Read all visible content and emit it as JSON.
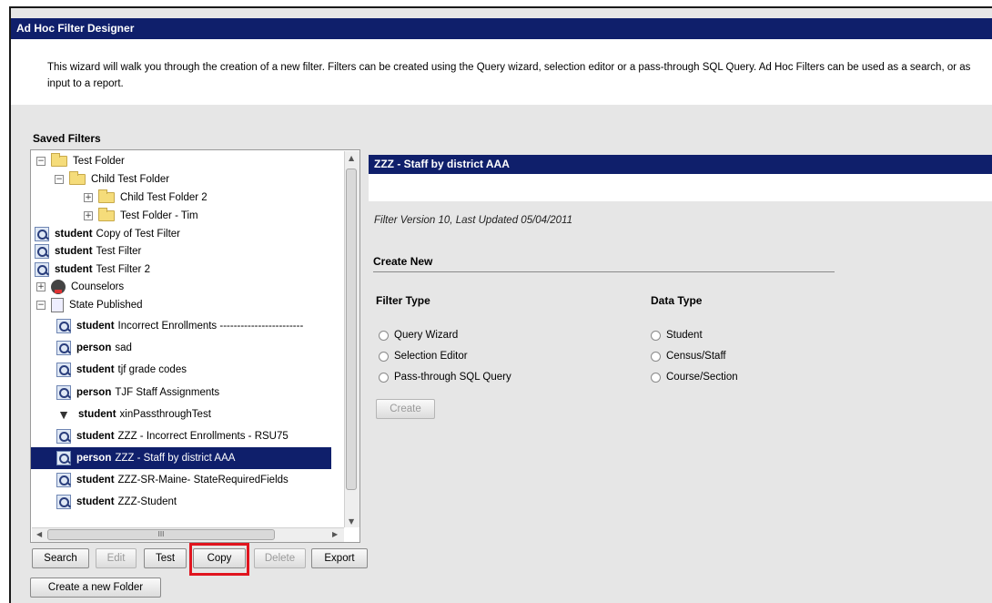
{
  "window": {
    "title": "Ad Hoc Filter Designer"
  },
  "intro": {
    "text": "This wizard will walk you through the creation of a new filter. Filters can be created using the Query wizard, selection editor or a pass-through SQL Query. Ad Hoc Filters can be used as a search, or as input to a report."
  },
  "saved_filters": {
    "label": "Saved Filters",
    "items": [
      {
        "type": "folder",
        "expander": "−",
        "label": "Test Folder"
      },
      {
        "type": "folder",
        "expander": "−",
        "label": "Child Test Folder"
      },
      {
        "type": "folder",
        "expander": "+",
        "label": "Child Test Folder 2"
      },
      {
        "type": "folder",
        "expander": "+",
        "label": "Test Folder - Tim"
      },
      {
        "type": "query",
        "prefix": "student",
        "label": "Copy of Test Filter"
      },
      {
        "type": "query",
        "prefix": "student",
        "label": "Test Filter"
      },
      {
        "type": "query",
        "prefix": "student",
        "label": "Test Filter 2"
      },
      {
        "type": "group",
        "expander": "+",
        "label": "Counselors"
      },
      {
        "type": "state",
        "expander": "−",
        "label": "State Published"
      },
      {
        "type": "query",
        "prefix": "student",
        "label": "Incorrect Enrollments ------------------------"
      },
      {
        "type": "query",
        "prefix": "person",
        "label": "sad"
      },
      {
        "type": "query",
        "prefix": "student",
        "label": "tjf grade codes"
      },
      {
        "type": "query",
        "prefix": "person",
        "label": "TJF Staff Assignments"
      },
      {
        "type": "passthrough",
        "prefix": "student",
        "label": "xinPassthroughTest"
      },
      {
        "type": "query",
        "prefix": "student",
        "label": "ZZZ - Incorrect Enrollments - RSU75"
      },
      {
        "type": "query",
        "prefix": "person",
        "label": "ZZZ - Staff by district AAA",
        "selected": true
      },
      {
        "type": "query",
        "prefix": "student",
        "label": "ZZZ-SR-Maine- StateRequiredFields"
      },
      {
        "type": "query",
        "prefix": "student",
        "label": "ZZZ-Student"
      }
    ],
    "scroll_grip": "III"
  },
  "buttons": {
    "search": "Search",
    "edit": "Edit",
    "test": "Test",
    "copy": "Copy",
    "delete": "Delete",
    "export": "Export",
    "new_folder": "Create a new Folder"
  },
  "detail": {
    "title": "ZZZ - Staff by district AAA",
    "version": "Filter Version 10,   Last Updated 05/04/2011",
    "create_new": "Create New",
    "filter_type_label": "Filter Type",
    "data_type_label": "Data Type",
    "filter_types": [
      "Query Wizard",
      "Selection Editor",
      "Pass-through SQL Query"
    ],
    "data_types": [
      "Student",
      "Census/Staff",
      "Course/Section"
    ],
    "create_button": "Create"
  },
  "colors": {
    "title_bar": "#0f1f6b",
    "panel_bg": "#e6e6e6",
    "highlight": "#e0141e"
  }
}
